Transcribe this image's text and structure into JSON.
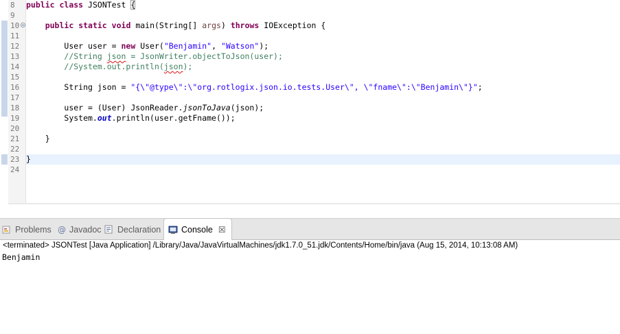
{
  "editor": {
    "line_numbers": [
      "8",
      "9",
      "10",
      "11",
      "12",
      "13",
      "14",
      "15",
      "16",
      "17",
      "18",
      "19",
      "20",
      "21",
      "22",
      "23",
      "24"
    ],
    "lines": {
      "l8": {
        "kw1": "public",
        "kw2": "class",
        "name": "JSONTest",
        "brace": "{"
      },
      "l10": {
        "kw1": "public",
        "kw2": "static",
        "kw3": "void",
        "sig": "main(String[] ",
        "param": "args",
        "close": ") ",
        "kw4": "throws",
        "rest": " IOException {"
      },
      "l12": {
        "pre": "User user = ",
        "kw": "new",
        "mid": " User(",
        "s1": "\"Benjamin\"",
        "comma": ", ",
        "s2": "\"Watson\"",
        "end": ");"
      },
      "l13": {
        "a": "//String ",
        "sq": "json",
        "b": " = JsonWriter.objectToJson(user);"
      },
      "l14": {
        "a": "//System.out.println(",
        "sq": "json",
        "b": ");"
      },
      "l16": {
        "pre": "String json = ",
        "str": "\"{\\\"@type\\\":\\\"org.rotlogix.json.io.tests.User\\\", \\\"fname\\\":\\\"Benjamin\\\"}\"",
        "end": ";"
      },
      "l18": {
        "pre": "user = (User) JsonReader.",
        "it": "jsonToJava",
        "end": "(json);"
      },
      "l19": {
        "pre": "System.",
        "fld": "out",
        "end": ".println(user.getFname());"
      },
      "l21": {
        "text": "}"
      },
      "l23": {
        "text": "}"
      }
    }
  },
  "views": {
    "tabs": [
      {
        "label": "Problems"
      },
      {
        "label": "Javadoc"
      },
      {
        "label": "Declaration"
      },
      {
        "label": "Console"
      }
    ],
    "close_glyph": "☒"
  },
  "console": {
    "header": "<terminated> JSONTest [Java Application] /Library/Java/JavaVirtualMachines/jdk1.7.0_51.jdk/Contents/Home/bin/java (Aug 15, 2014, 10:13:08 AM)",
    "output": "Benjamin"
  },
  "colors": {
    "keyword": "#7f0055",
    "string": "#2a00ff",
    "comment": "#3f7f5f",
    "field": "#0000c0",
    "current_line": "#e8f2fe"
  }
}
